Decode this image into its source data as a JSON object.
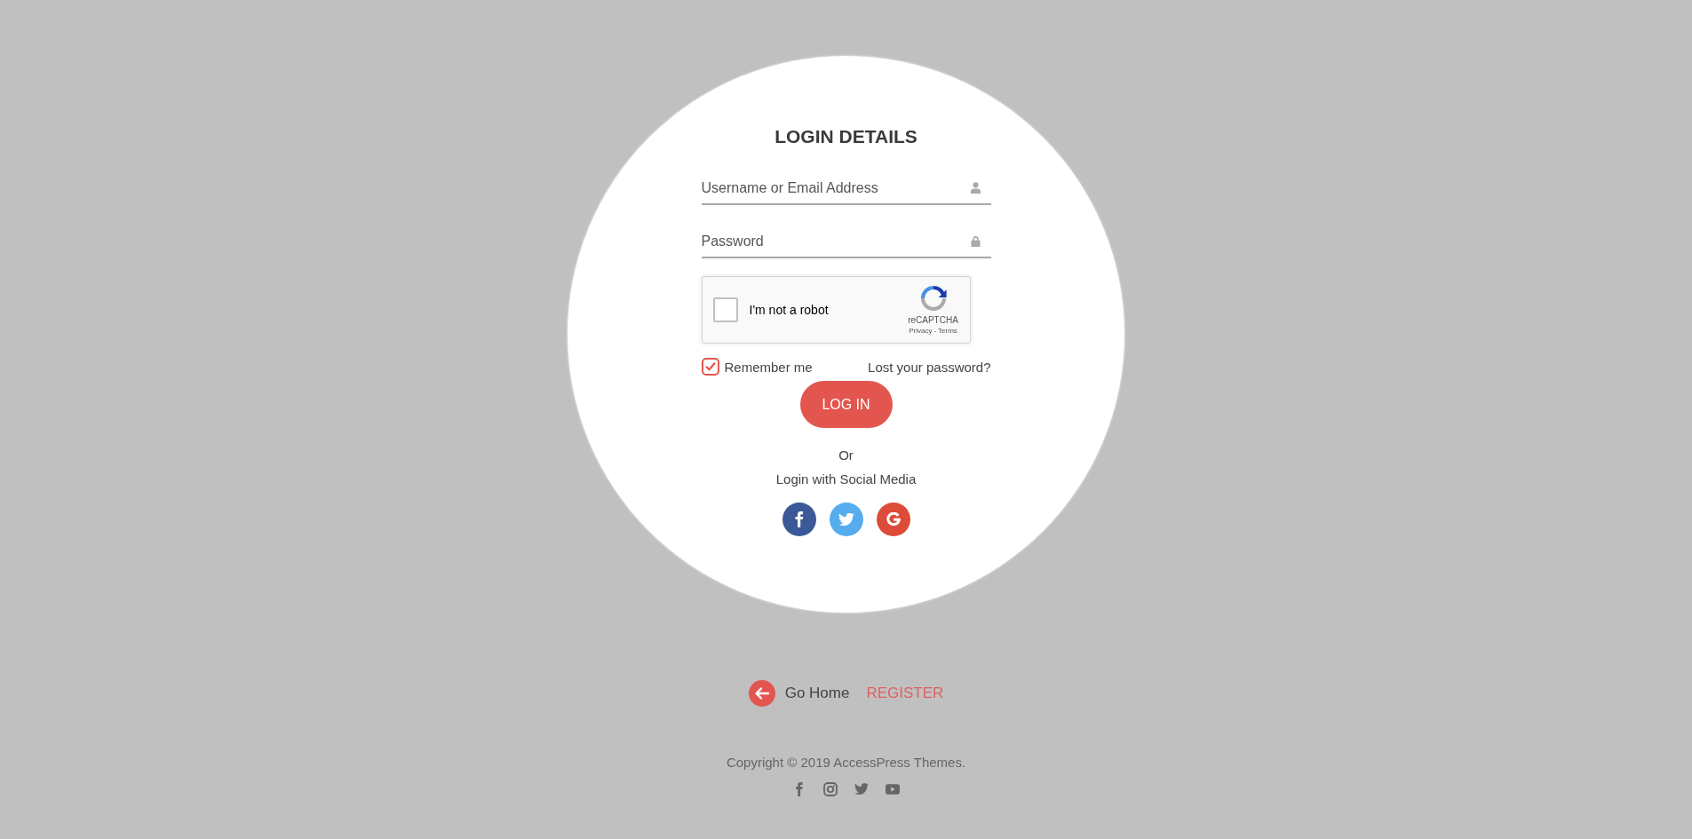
{
  "title": "LOGIN DETAILS",
  "fields": [
    {
      "kind": "username",
      "placeholder": "Username or Email Address"
    },
    {
      "kind": "password",
      "placeholder": "Password"
    }
  ],
  "captcha": {
    "label": "I'm not a robot",
    "checked": false,
    "brand": "reCAPTCHA",
    "links": [
      "Privacy",
      "Terms"
    ],
    "separator": "-"
  },
  "remember": {
    "label": "Remember me",
    "checked": true
  },
  "lost_password": "Lost your password?",
  "login_button": "LOG IN",
  "or": "Or",
  "social_heading": "Login with Social Media",
  "social_buttons": [
    {
      "kind": "facebook",
      "color": "#3b5998"
    },
    {
      "kind": "twitter",
      "color": "#55acee"
    },
    {
      "kind": "google",
      "color": "#dd4b39"
    }
  ],
  "footer": {
    "go_home": "Go Home",
    "register": "REGISTER",
    "copyright": "Copyright © 2019 AccessPress Themes.",
    "social_links": [
      {
        "kind": "facebook"
      },
      {
        "kind": "instagram"
      },
      {
        "kind": "twitter"
      },
      {
        "kind": "youtube"
      }
    ]
  }
}
